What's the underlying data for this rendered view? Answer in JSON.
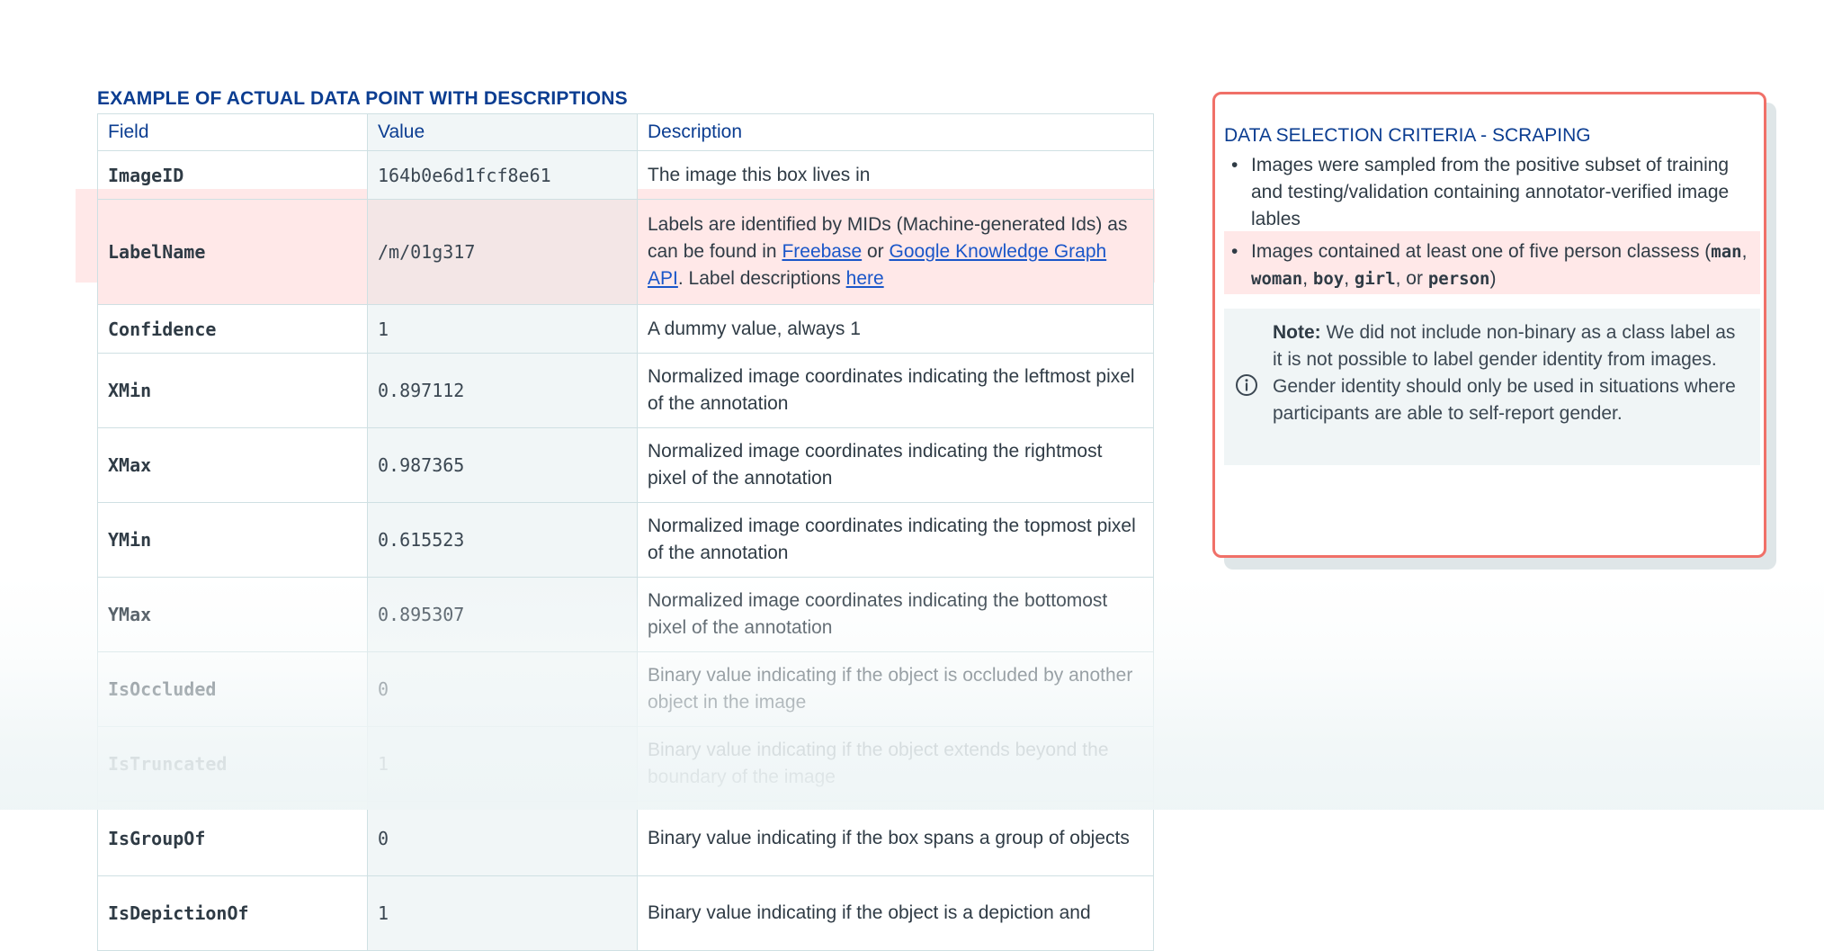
{
  "table_section": {
    "title": "EXAMPLE OF ACTUAL DATA POINT WITH DESCRIPTIONS",
    "headers": [
      "Field",
      "Value",
      "Description"
    ],
    "rows": [
      {
        "field": "ImageID",
        "value": "164b0e6d1fcf8e61",
        "description": "The image this box lives in"
      },
      {
        "field": "LabelName",
        "value": "/m/01g317",
        "description": "Labels are identified by MIDs (Machine-generated Ids) as can be found in Freebase or Google Knowledge Graph API. Label descriptions here"
      },
      {
        "field": "Confidence",
        "value": "1",
        "description": "A dummy value, always 1"
      },
      {
        "field": "XMin",
        "value": "0.897112",
        "description": "Normalized image coordinates indicating the leftmost pixel of the annotation"
      },
      {
        "field": "XMax",
        "value": "0.987365",
        "description": "Normalized image coordinates indicating the rightmost pixel of the annotation"
      },
      {
        "field": "YMin",
        "value": "0.615523",
        "description": "Normalized image coordinates indicating the topmost pixel of the annotation"
      },
      {
        "field": "YMax",
        "value": "0.895307",
        "description": "Normalized image coordinates indicating the bottomost pixel of the annotation"
      },
      {
        "field": "IsOccluded",
        "value": "0",
        "description": "Binary value indicating if the object is occluded by another object in the image"
      },
      {
        "field": "IsTruncated",
        "value": "1",
        "description": "Binary value indicating if the object extends beyond the boundary of the image"
      },
      {
        "field": "IsGroupOf",
        "value": "0",
        "description": "Binary value indicating if the box spans a group of objects"
      },
      {
        "field": "IsDepictionOf",
        "value": "1",
        "description": "Binary value indicating if the object is a depiction and"
      }
    ],
    "labelname_desc": {
      "prefix": "Labels are identified by MIDs (Machine-generated Ids) as can be found in ",
      "link_freebase": "Freebase",
      "mid_or": " or ",
      "link_gkg": "Google Knowledge Graph API",
      "mid_labels": ". Label descriptions ",
      "link_here": "here"
    }
  },
  "criteria_card": {
    "title": "DATA SELECTION CRITERIA - SCRAPING",
    "item1": "Images were sampled from the positive subset of training and testing/validation containing annotator-verified image lables",
    "item2": {
      "text": "Images contained at least one of five person classess (",
      "classes": [
        "man",
        "woman",
        "boy",
        "girl",
        "person"
      ],
      "sep_comma": ", ",
      "sep_or": ", or ",
      "close": ")"
    },
    "note": {
      "label": "Note:",
      "text": " We did not include non-binary as a class label as it is not possible to label gender identity from images. Gender identity should only be used in situations where participants are able to self-report gender.",
      "icon": "info-icon"
    }
  },
  "colors": {
    "heading": "#0b3d91",
    "link": "#1a56c9",
    "highlight": "#ffe8e8",
    "card_border": "#f07068",
    "note_bg": "#f0f5f6"
  }
}
